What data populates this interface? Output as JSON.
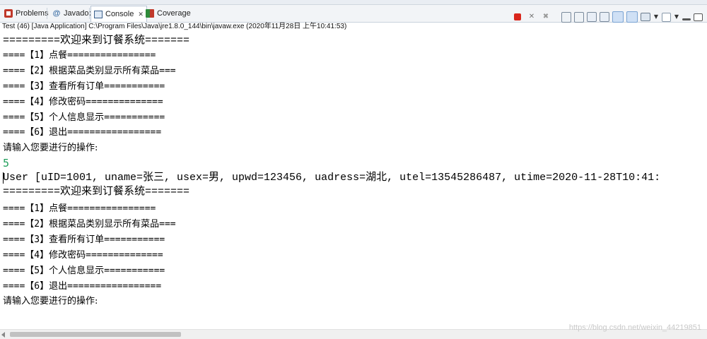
{
  "tabs": [
    {
      "label": "Problems",
      "icon": "problems-icon",
      "active": false
    },
    {
      "label": "Javadoc",
      "icon": "javadoc-icon",
      "active": false
    },
    {
      "label": "Console",
      "icon": "console-icon",
      "active": true
    },
    {
      "label": "Coverage",
      "icon": "coverage-icon",
      "active": false
    }
  ],
  "javadoc_glyph": "@",
  "toolbar": {
    "terminate_icon": "stop-icon",
    "remove_launch_icon": "close-icon",
    "remove_all_icon": "close-all-icon",
    "x_glyph": "✕",
    "xx_glyph": "✖"
  },
  "process_path": "Test (46) [Java Application] C:\\Program Files\\Java\\jre1.8.0_144\\bin\\javaw.exe (2020年11月28日 上午10:41:53)",
  "console": {
    "header": "=========欢迎来到订餐系统=======",
    "menu": [
      "====【1】点餐================",
      "====【2】根据菜品类别显示所有菜品===",
      "====【3】查看所有订单===========",
      "====【4】修改密码==============",
      "====【5】个人信息显示===========",
      "====【6】退出================="
    ],
    "prompt": "请输入您要进行的操作:",
    "user_input": "5",
    "user_output": "User [uID=1001, uname=张三, usex=男, upwd=123456, uadress=湖北, utel=13545286487, utime=2020-11-28T10:41:",
    "header2": "=========欢迎来到订餐系统=======",
    "prompt2": "请输入您要进行的操作:"
  },
  "watermark": "https://blog.csdn.net/weixin_44219851",
  "colors": {
    "input_green": "#1f9e5a",
    "terminate_red": "#d9261c",
    "tab_bar": "#f2f4f7"
  }
}
